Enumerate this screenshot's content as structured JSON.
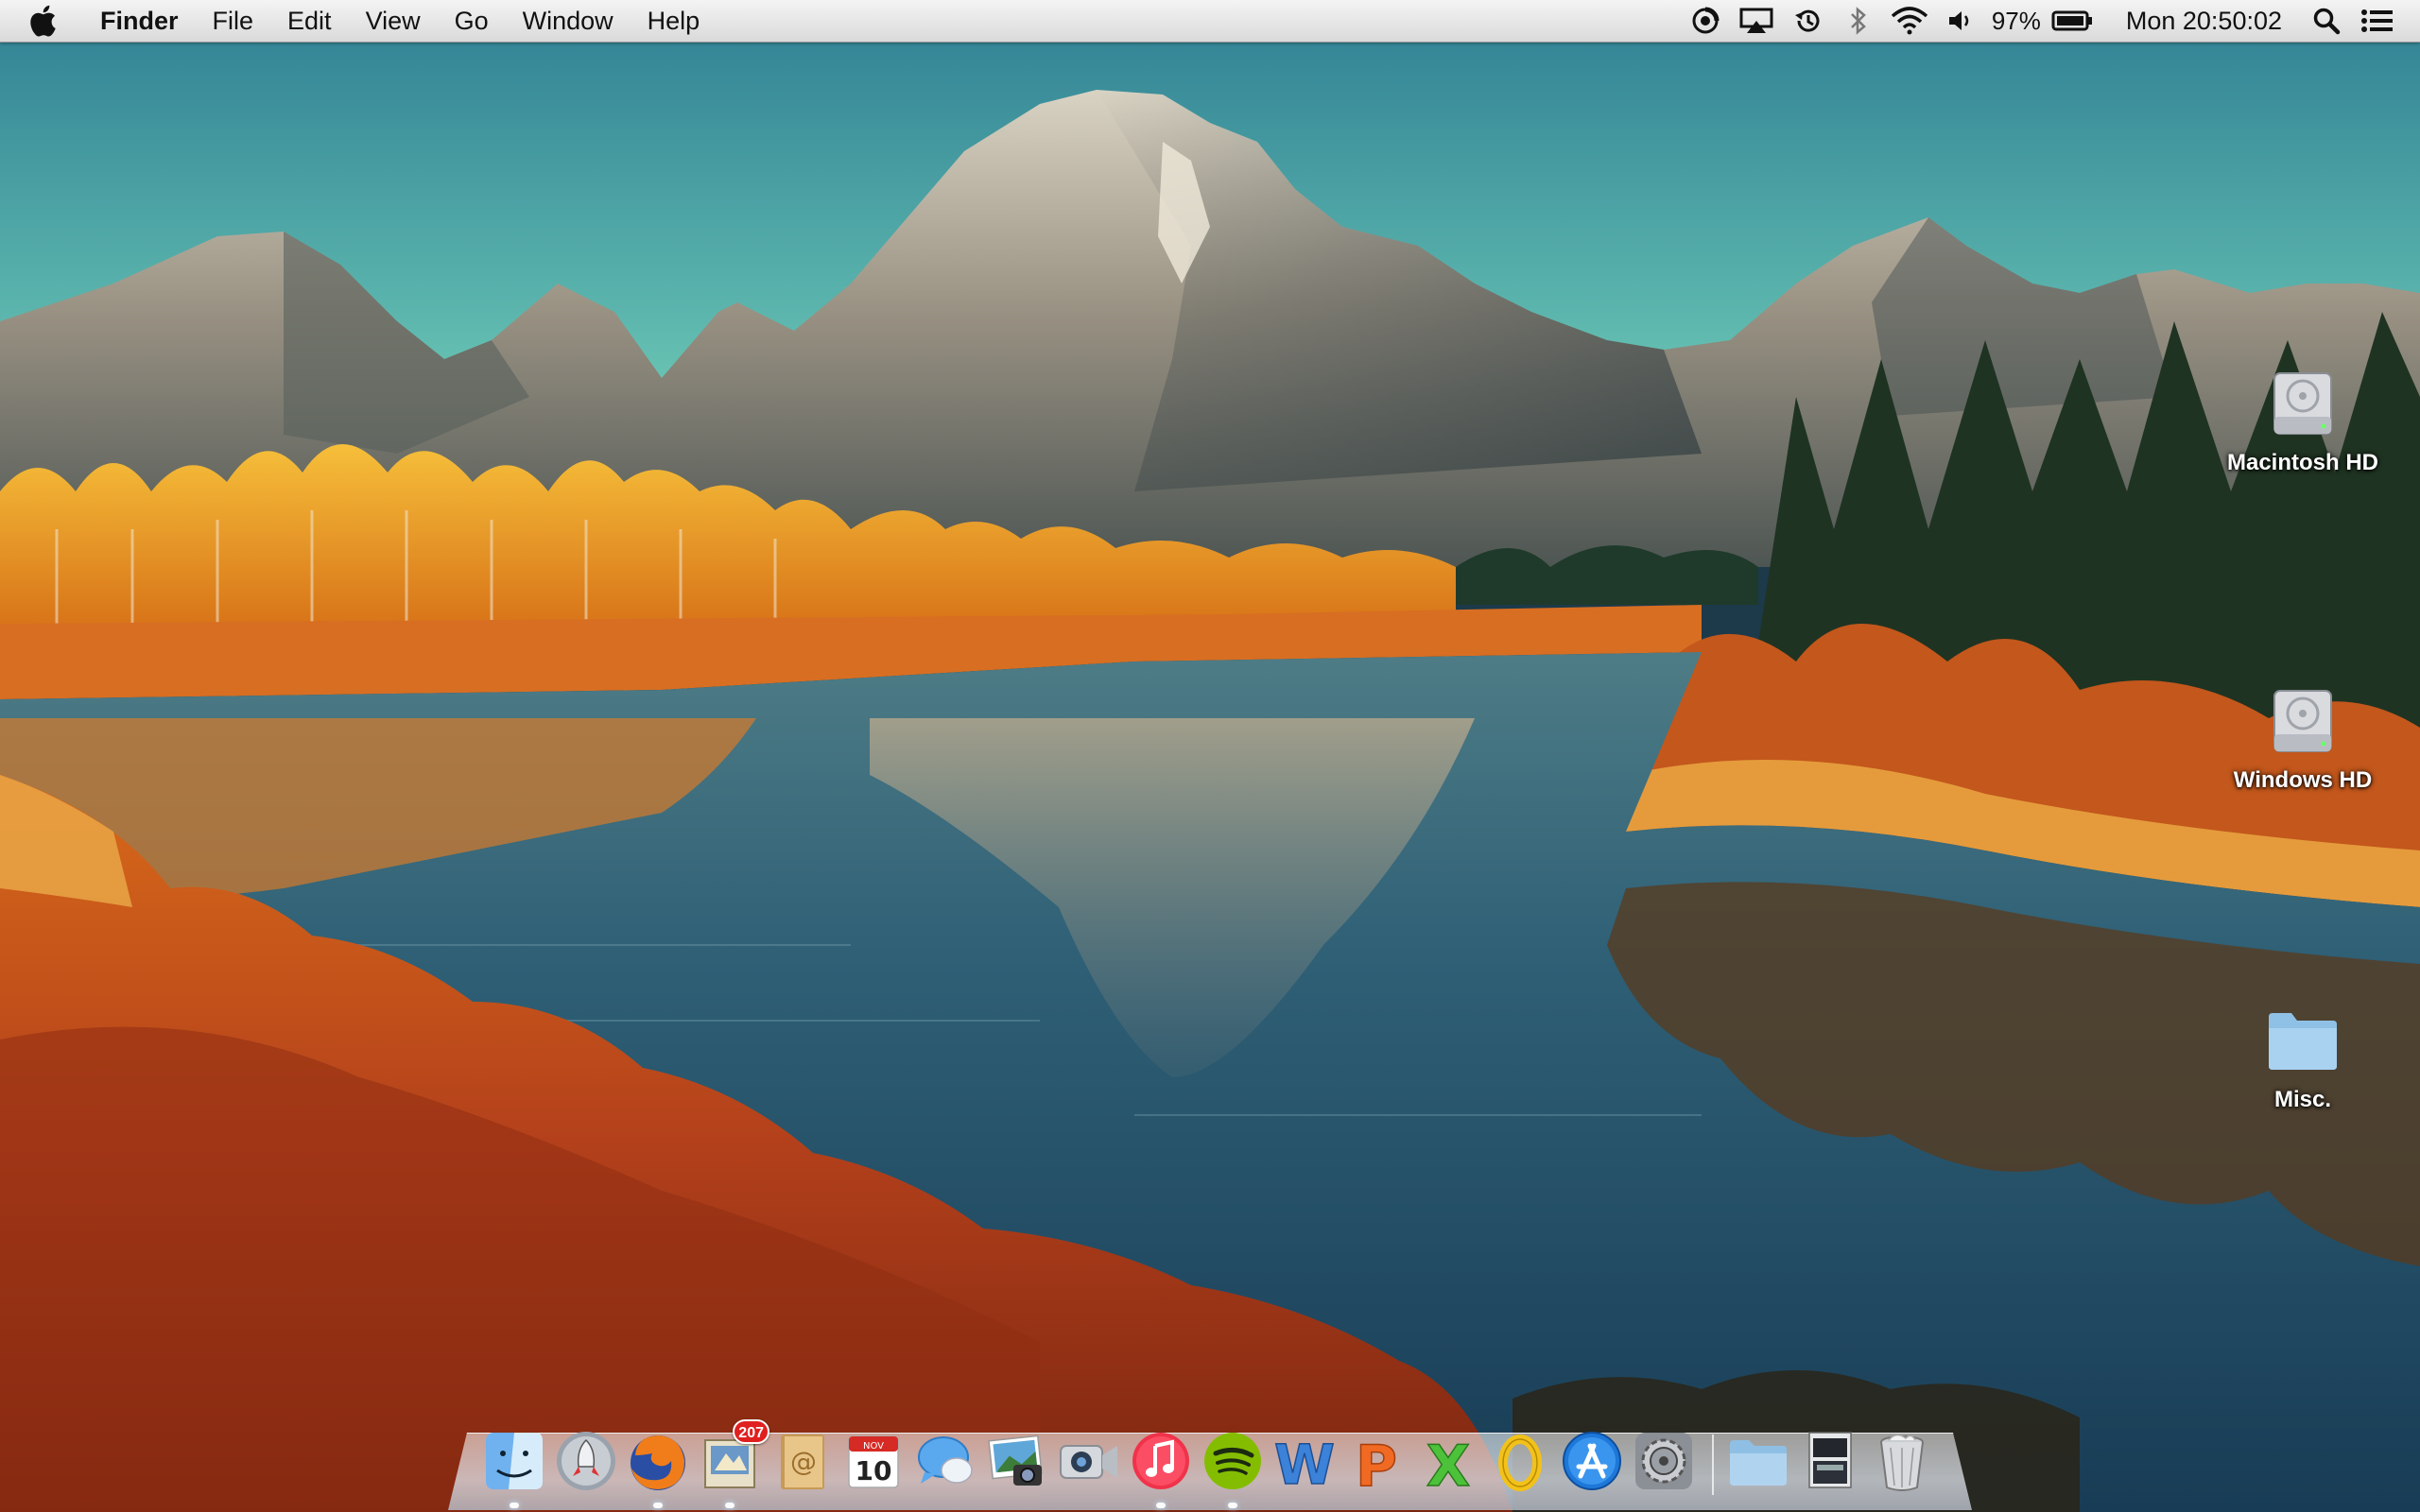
{
  "menubar": {
    "app_name": "Finder",
    "menus": [
      "File",
      "Edit",
      "View",
      "Go",
      "Window",
      "Help"
    ],
    "battery_percent": "97%",
    "clock": "Mon 20:50:02"
  },
  "desktop": {
    "icons": [
      {
        "label": "Macintosh HD",
        "icon": "hard-drive-icon"
      },
      {
        "label": "Windows HD",
        "icon": "hard-drive-icon"
      },
      {
        "label": "Misc.",
        "icon": "folder-icon"
      }
    ]
  },
  "dock": {
    "apps": [
      "finder",
      "launchpad",
      "firefox",
      "mail",
      "contacts",
      "calendar",
      "messages",
      "iphoto",
      "facetime",
      "itunes",
      "spotify",
      "word",
      "powerpoint",
      "excel",
      "outlook",
      "app-store",
      "system-preferences"
    ],
    "mail_badge": "207",
    "calendar_month": "NOV",
    "calendar_day": "10",
    "stack_items": [
      "downloads-folder",
      "documents-stack",
      "trash"
    ]
  },
  "colors": {
    "sky_top": "#3e8a9a",
    "sky_horizon": "#88e6c4",
    "water": "#1f4a63",
    "autumn_orange": "#e07a1c",
    "autumn_red": "#b8401a"
  }
}
